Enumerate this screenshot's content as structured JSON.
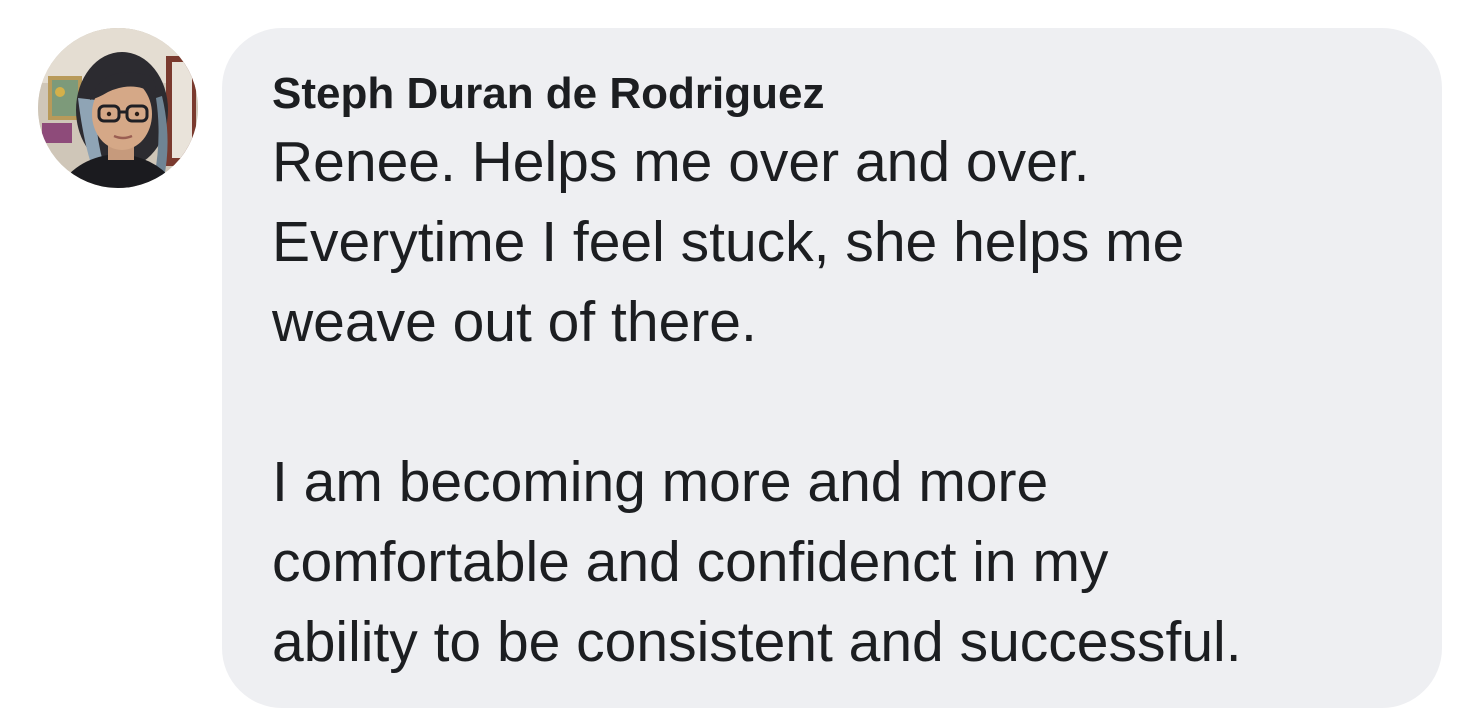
{
  "comment": {
    "author": "Steph Duran de Rodriguez",
    "avatar_icon": "profile-photo",
    "paragraphs": [
      {
        "lines": [
          "Renee. Helps me over and over.",
          "Everytime I feel stuck, she helps me",
          "weave out of there."
        ]
      },
      {
        "lines": [
          "I am becoming more and more",
          "comfortable and confidenct in my",
          "ability to be consistent and successful."
        ]
      }
    ]
  },
  "colors": {
    "bubble_background": "#eeeff2",
    "text": "#1c1e21",
    "page_background": "#ffffff"
  }
}
